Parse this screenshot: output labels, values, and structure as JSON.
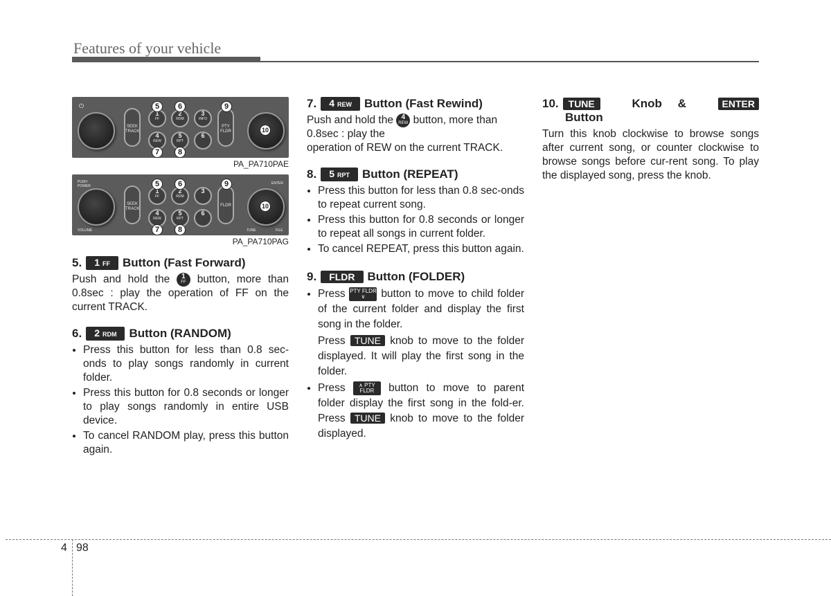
{
  "header": {
    "title": "Features of your vehicle"
  },
  "panels": [
    {
      "caption": "PA_PA710PAE",
      "power_label": "⏻",
      "volume_label": "",
      "pill_left": "SEEK TRACK",
      "pill_right": "PTY FLDR",
      "enter_label": "",
      "tune_label": "",
      "file_label": "",
      "buttons": [
        {
          "n": "1",
          "s": "FF"
        },
        {
          "n": "2",
          "s": "RDM"
        },
        {
          "n": "3",
          "s": "INFO"
        },
        {
          "n": "4",
          "s": "REW"
        },
        {
          "n": "5",
          "s": "RPT"
        },
        {
          "n": "6",
          "s": ""
        }
      ]
    },
    {
      "caption": "PA_PA710PAG",
      "power_label": "PUSH POWER",
      "volume_label": "VOLUME",
      "pill_left": "SEEK TRACK",
      "pill_right": "FLDR",
      "enter_label": "ENTER",
      "tune_label": "TUNE",
      "file_label": "FILE",
      "buttons": [
        {
          "n": "1",
          "s": "FF"
        },
        {
          "n": "2",
          "s": "RDM"
        },
        {
          "n": "3",
          "s": ""
        },
        {
          "n": "4",
          "s": "REW"
        },
        {
          "n": "5",
          "s": "RPT"
        },
        {
          "n": "6",
          "s": ""
        }
      ]
    }
  ],
  "callouts": [
    "5",
    "6",
    "7",
    "8",
    "9",
    "10"
  ],
  "sections": {
    "s5": {
      "num": "5.",
      "tag_num": "1",
      "tag_sub": "FF",
      "title": "Button (Fast Forward)",
      "p1": "Push and hold the",
      "icon_num": "1",
      "icon_sub": "FF",
      "p2": "button, more than 0.8sec : play the operation of FF on the current TRACK."
    },
    "s6": {
      "num": "6.",
      "tag_num": "2",
      "tag_sub": "RDM",
      "title": "Button (RANDOM)",
      "bullets": [
        "Press this button for less than 0.8 sec-onds to play songs randomly in current folder.",
        "Press this button for 0.8 seconds or longer to play songs randomly in entire USB device.",
        "To cancel RANDOM play, press this button again."
      ]
    },
    "s7": {
      "num": "7.",
      "tag_num": "4",
      "tag_sub": "REW",
      "title": "Button (Fast Rewind)",
      "p1": "Push and hold the",
      "icon_num": "4",
      "icon_sub": "REW",
      "p2": "button, more than 0.8sec : play the",
      "p3": "operation of REW on the current TRACK."
    },
    "s8": {
      "num": "8.",
      "tag_num": "5",
      "tag_sub": "RPT",
      "title": "Button (REPEAT)",
      "bullets": [
        "Press this button for less than 0.8 sec-onds to repeat current song.",
        "Press this button for 0.8 seconds or longer to repeat all songs in current folder.",
        "To cancel REPEAT, press this button again."
      ]
    },
    "s9": {
      "num": "9.",
      "tag": "FLDR",
      "title": "Button (FOLDER)",
      "b1_pre": "Press",
      "b1_icon": "PTY FLDR ∨",
      "b1_post": "button to move to child folder of the current folder and display the first song in the folder.",
      "b1b_pre": "Press",
      "b1b_tag": "TUNE",
      "b1b_post": "knob to move to the folder displayed. It will play the first song in the folder.",
      "b2_pre": "Press",
      "b2_icon": "∧ PTY FLDR",
      "b2_post": "button to move to parent folder display the first song in the fold-er. Press",
      "b2_tag": "TUNE",
      "b2_end": "knob to move to the folder displayed."
    },
    "s10": {
      "num": "10.",
      "tag1": "TUNE",
      "mid": "Knob &",
      "tag2": "ENTER",
      "title2": "Button",
      "body": "Turn this knob clockwise to browse songs after current song, or counter clockwise to browse songs before cur-rent song. To play the displayed song, press the knob."
    }
  },
  "footer": {
    "chapter": "4",
    "page": "98"
  }
}
